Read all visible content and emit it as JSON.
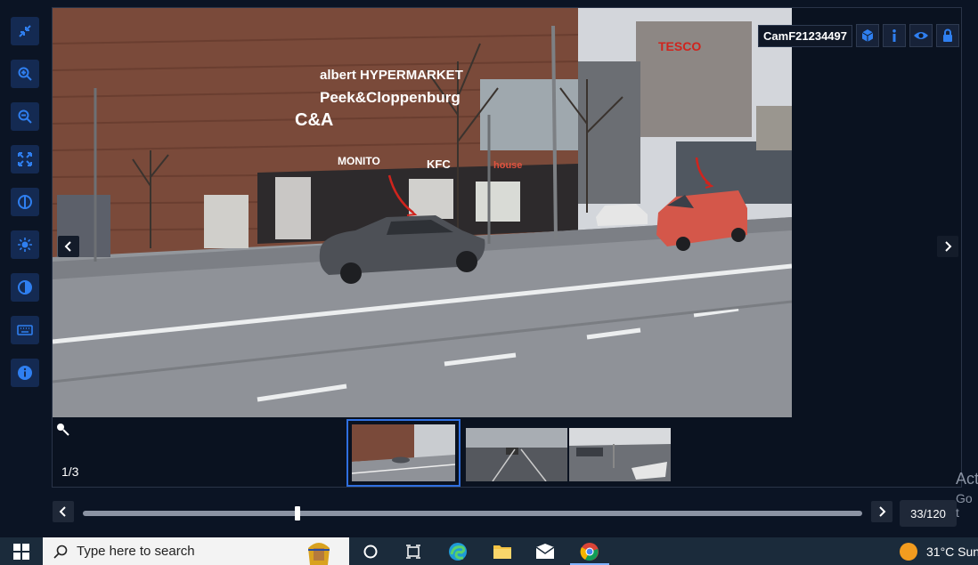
{
  "toolbar": {
    "tools": [
      {
        "name": "collapse-icon"
      },
      {
        "name": "zoom-in-icon"
      },
      {
        "name": "zoom-out-icon"
      },
      {
        "name": "fit-screen-icon"
      },
      {
        "name": "rotate-icon"
      },
      {
        "name": "brightness-icon"
      },
      {
        "name": "contrast-icon"
      },
      {
        "name": "keyboard-icon"
      },
      {
        "name": "info-icon"
      }
    ]
  },
  "viewer": {
    "camera_label": "CamF21234497",
    "camera_actions": [
      "cube-icon",
      "info-icon",
      "eye-icon",
      "lock-icon"
    ],
    "store_signs": [
      "albert HYPERMARKET",
      "Peek&Cloppenburg",
      "C&A",
      "MONITO",
      "KFC",
      "house",
      "TESCO"
    ],
    "page_counter": "1/3",
    "thumbnail_count": 3,
    "active_thumbnail": 1
  },
  "timeline": {
    "frame_counter": "33/120",
    "position": 0.275
  },
  "watermark": {
    "line1": "Act",
    "line2": "Go t"
  },
  "taskbar": {
    "search_placeholder": "Type here to search",
    "weather_temp": "31°C",
    "weather_text": "Sun"
  },
  "colors": {
    "accent": "#2f6fe0",
    "toolbar_button": "#142a52",
    "icon_blue": "#2f7ff0"
  }
}
